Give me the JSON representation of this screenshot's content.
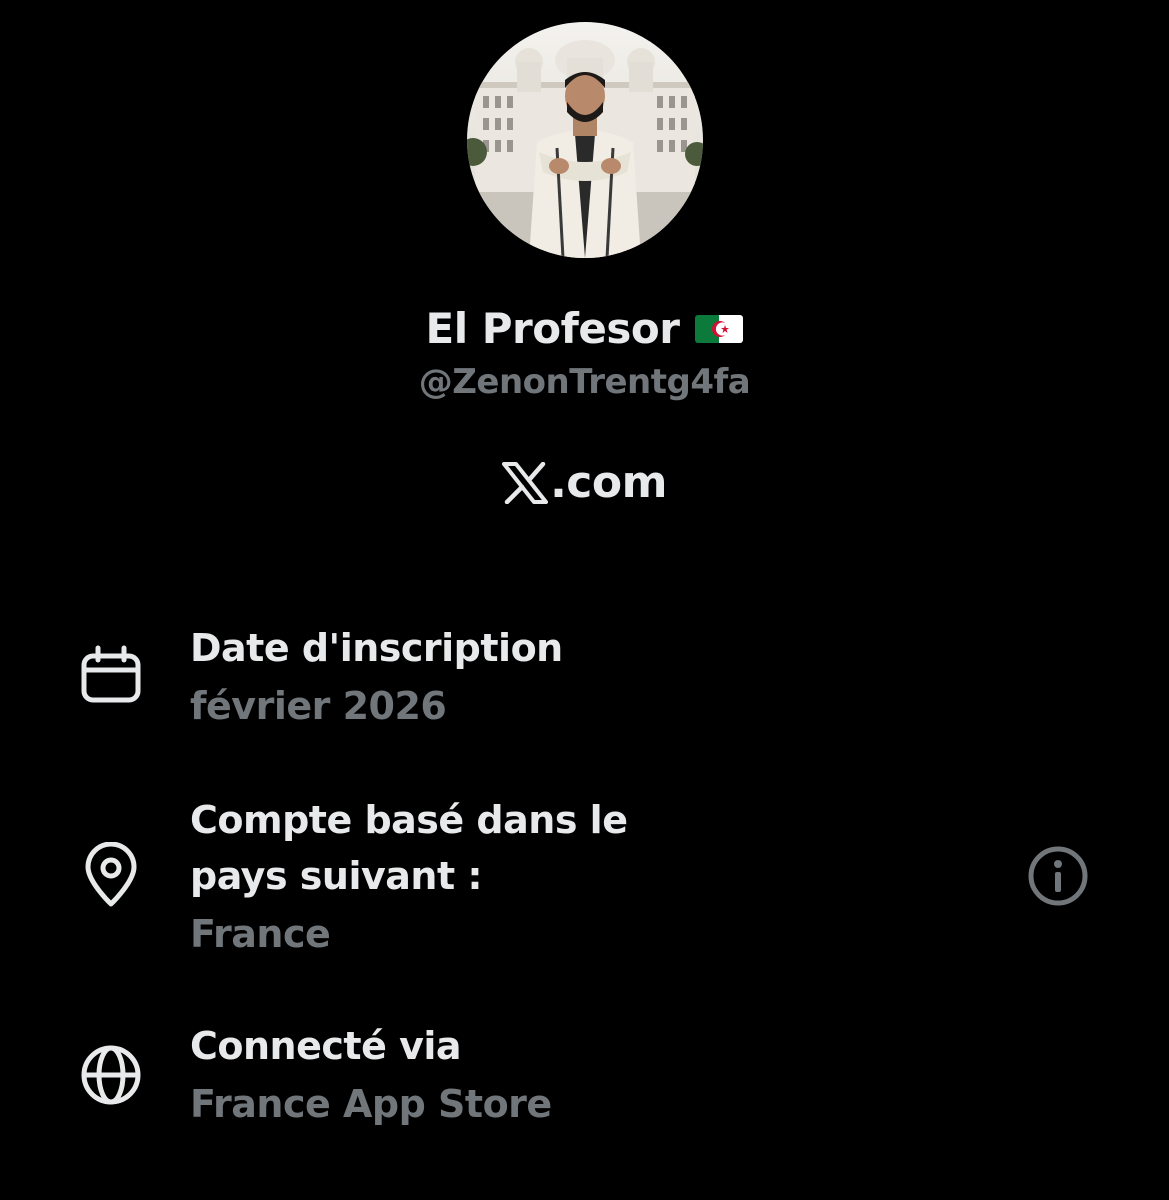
{
  "profile": {
    "display_name": "El Profesor",
    "handle": "@ZenonTrentg4fa",
    "site": ".com",
    "avatar_icon": "profile-photo",
    "flag_icon": "algeria-flag"
  },
  "details": {
    "joined": {
      "icon": "calendar-icon",
      "title": "Date d'inscription",
      "value": "février 2026"
    },
    "location": {
      "icon": "location-pin-icon",
      "title_line1": "Compte basé dans le",
      "title_line2": "pays suivant :",
      "value": "France",
      "info_icon": "info-icon"
    },
    "connected": {
      "icon": "globe-icon",
      "title": "Connecté via",
      "value": "France App Store"
    }
  },
  "colors": {
    "background": "#000000",
    "primary_text": "#e7e9ea",
    "secondary_text": "#71767b"
  }
}
